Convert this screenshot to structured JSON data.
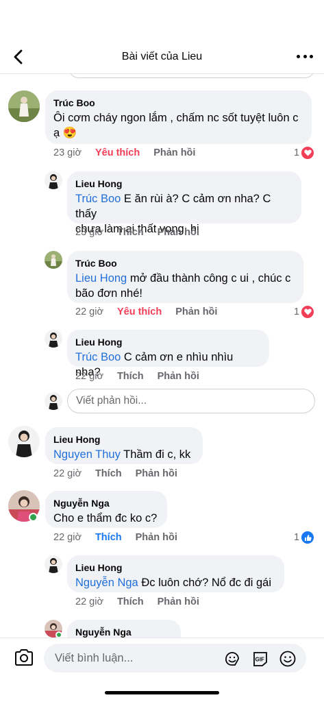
{
  "header": {
    "title": "Bài viết của Lieu"
  },
  "comments": [
    {
      "author": "Trúc Boo",
      "text_line1": "Ôi cơm cháy ngon lắm , chấm nc sốt tuyệt luôn c",
      "text_line2": "ạ",
      "emoji": "😍",
      "time": "23 giờ",
      "like_label": "Yêu thích",
      "reply_label": "Phản hồi",
      "reaction_count": "1",
      "reaction": "heart-icon",
      "replies": [
        {
          "author": "Lieu Hong",
          "mention": "Trúc Boo",
          "text_line1": " E ăn rùi à? C cảm ơn nha? C thấy",
          "text_line2": "chưa làm ai thất vọng, hi",
          "time": "23 giờ",
          "like_label": "Thích",
          "reply_label": "Phản hồi"
        },
        {
          "author": "Trúc Boo",
          "mention": "Lieu Hong",
          "text_line1": " mở đầu thành công c ui , chúc c",
          "text_line2": "bão đơn nhé!",
          "time": "22 giờ",
          "like_label": "Yêu thích",
          "reply_label": "Phản hồi",
          "reaction_count": "1",
          "reaction": "heart-icon"
        },
        {
          "author": "Lieu Hong",
          "mention": "Trúc Boo",
          "text_line1": " C cảm ơn e nhìu nhìu nha?",
          "time": "22 giờ",
          "like_label": "Thích",
          "reply_label": "Phản hồi"
        }
      ],
      "reply_placeholder": "Viết phản hồi..."
    },
    {
      "author": "Lieu Hong",
      "mention": "Nguyen Thuy",
      "text_line1": " Thầm đi c, kk",
      "time": "22 giờ",
      "like_label": "Thích",
      "reply_label": "Phản hồi"
    },
    {
      "author": "Nguyễn Nga",
      "text_line1": "Cho e thẩm đc ko c?",
      "time": "22 giờ",
      "like_label": "Thích",
      "reply_label": "Phản hồi",
      "reaction_count": "1",
      "reaction": "like-icon",
      "replies": [
        {
          "author": "Lieu Hong",
          "mention": "Nguyễn Nga",
          "text_line1": " Đc luôn chớ? Nổ đc đi gái",
          "time": "22 giờ",
          "like_label": "Thích",
          "reply_label": "Phản hồi"
        },
        {
          "author": "Nguyễn Nga"
        }
      ]
    }
  ],
  "composer": {
    "placeholder": "Viết bình luận..."
  },
  "colors": {
    "mention": "#216fdb",
    "love": "#f33e58",
    "like": "#1877f2",
    "bubble": "#f0f2f5",
    "muted": "#65676b"
  }
}
